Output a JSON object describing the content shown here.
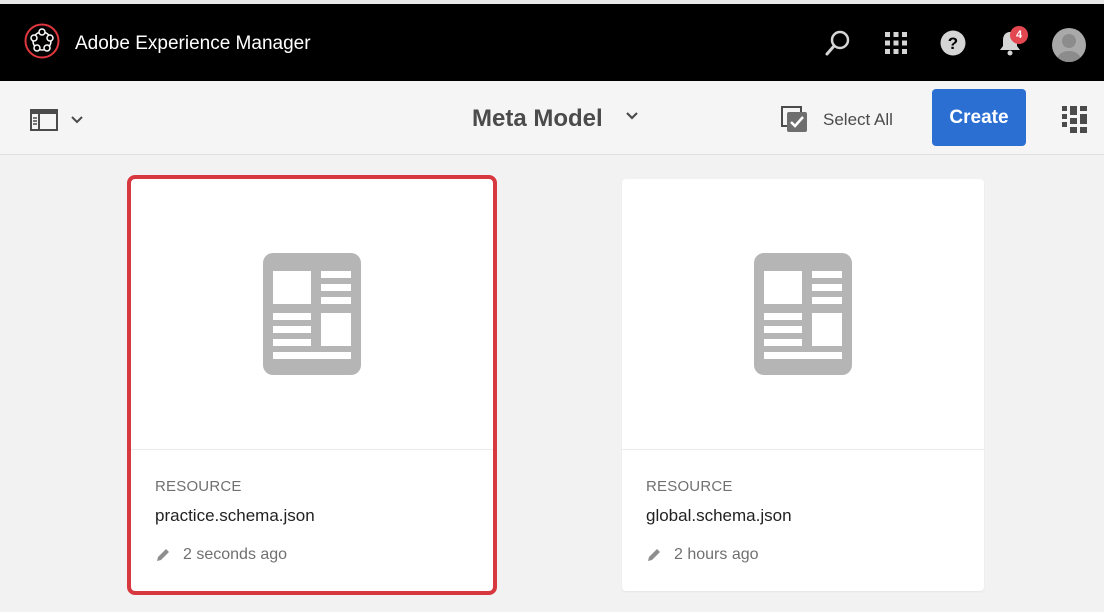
{
  "shell": {
    "app_title": "Adobe Experience Manager",
    "notification_count": "4",
    "icons": [
      "search-icon",
      "apps-grid-icon",
      "help-icon",
      "bell-icon",
      "avatar"
    ]
  },
  "actionbar": {
    "page_title": "Meta Model",
    "select_all_label": "Select All",
    "create_label": "Create"
  },
  "cards": [
    {
      "type": "RESOURCE",
      "name": "practice.schema.json",
      "modified": "2 seconds ago",
      "selected": true
    },
    {
      "type": "RESOURCE",
      "name": "global.schema.json",
      "modified": "2 hours ago",
      "selected": false
    }
  ],
  "colors": {
    "accent": "#2b6fd3",
    "selection": "#d7373f",
    "badge": "#e34850",
    "topbar": "#000000"
  }
}
